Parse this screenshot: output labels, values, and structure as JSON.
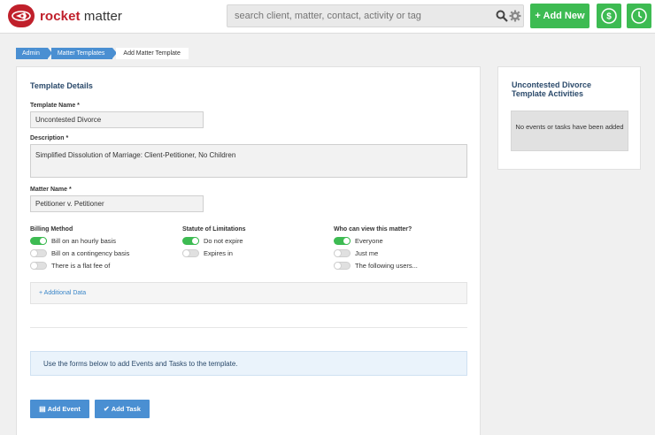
{
  "header": {
    "logo_text_brand": "rocket",
    "logo_text_rest": "matter",
    "search_placeholder": "search client, matter, contact, activity or tag",
    "add_new_label": "+ Add New",
    "icons": [
      "logo-icon",
      "search-icon",
      "gear-icon",
      "dollar-icon",
      "clock-icon"
    ],
    "accent_color": "#3dbb52",
    "brand_color": "#c0202b"
  },
  "breadcrumb": [
    "Admin",
    "Matter Templates",
    "Add Matter Template"
  ],
  "template_details": {
    "title": "Template Details",
    "template_name_label": "Template Name *",
    "template_name_value": "Uncontested Divorce",
    "description_label": "Description *",
    "description_value": "Simplified Dissolution of Marriage:  Client-Petitioner, No Children",
    "matter_name_label": "Matter Name *",
    "matter_name_value": "Petitioner v. Petitioner"
  },
  "billing": {
    "label": "Billing Method",
    "options": [
      {
        "label": "Bill on an hourly basis",
        "on": true
      },
      {
        "label": "Bill on a contingency basis",
        "on": false
      },
      {
        "label": "There is a flat fee of",
        "on": false
      }
    ]
  },
  "statute": {
    "label": "Statute of Limitations",
    "options": [
      {
        "label": "Do not expire",
        "on": true
      },
      {
        "label": "Expires in",
        "on": false
      }
    ]
  },
  "visibility": {
    "label": "Who can view this matter?",
    "options": [
      {
        "label": "Everyone",
        "on": true
      },
      {
        "label": "Just me",
        "on": false
      },
      {
        "label": "The following users...",
        "on": false
      }
    ]
  },
  "additional_data": "+ Additional Data",
  "info_text": "Use the forms below to add Events and Tasks to the template.",
  "buttons": {
    "add_event": "Add Event",
    "add_task": "Add Task"
  },
  "sidebar": {
    "title": "Uncontested Divorce Template Activities",
    "empty": "No events or tasks have been added"
  }
}
